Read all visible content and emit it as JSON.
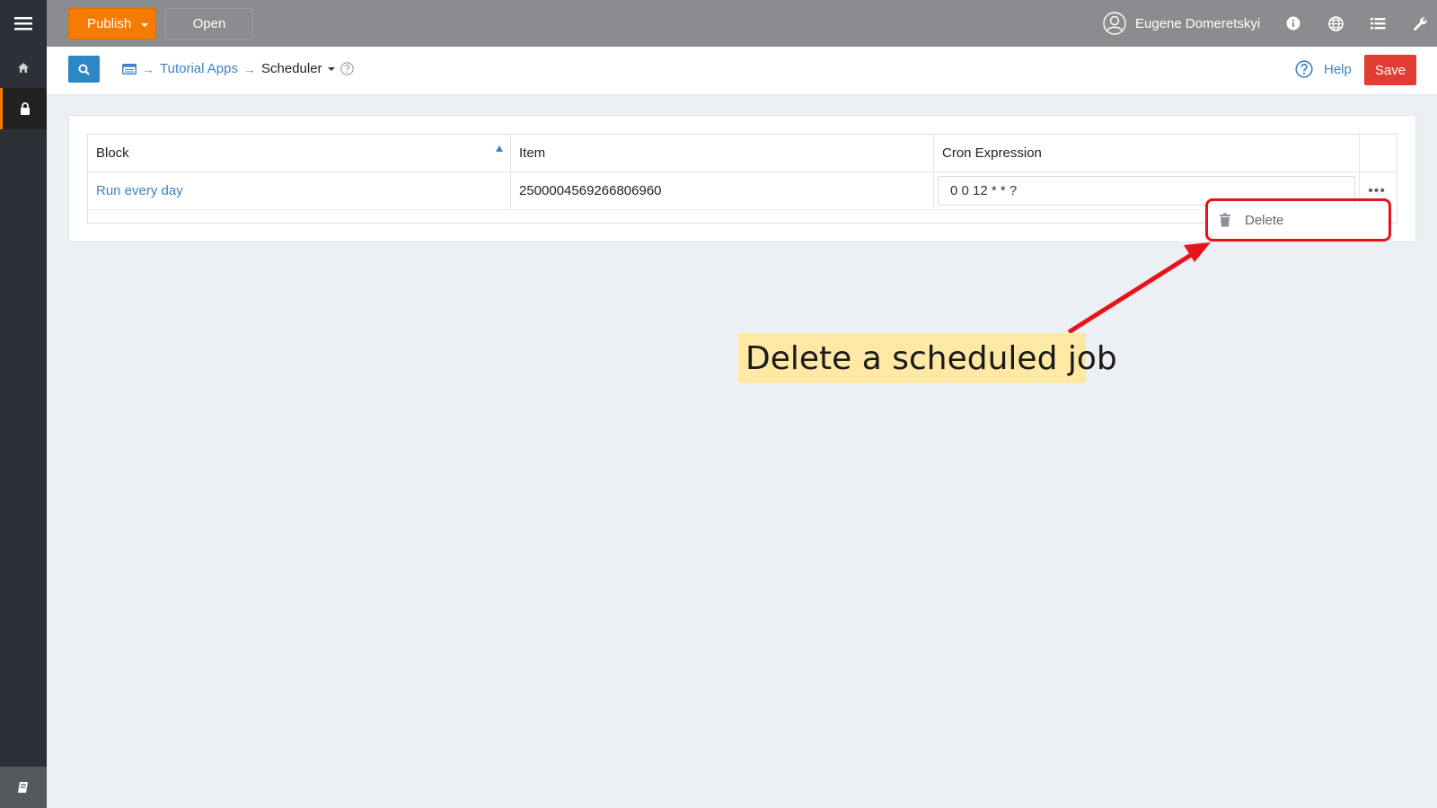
{
  "topbar": {
    "publish_label": "Publish",
    "open_label": "Open",
    "user_name": "Eugene Domeretskyi"
  },
  "breadcrumb": {
    "app_link": "Tutorial Apps",
    "current": "Scheduler"
  },
  "subbar": {
    "help_label": "Help",
    "save_label": "Save"
  },
  "table": {
    "columns": [
      "Block",
      "Item",
      "Cron Expression"
    ],
    "rows": [
      {
        "block": "Run every day",
        "item": "2500004569266806960",
        "cron": "0 0 12 * * ?"
      }
    ]
  },
  "context_menu": {
    "delete_label": "Delete"
  },
  "annotation": {
    "callout_text": "Delete a scheduled job"
  },
  "colors": {
    "accent_orange": "#f57c00",
    "primary_blue": "#2f86c4",
    "save_red": "#e23d33",
    "annotation_red": "#e8131a",
    "callout_yellow": "#fde8a4"
  }
}
